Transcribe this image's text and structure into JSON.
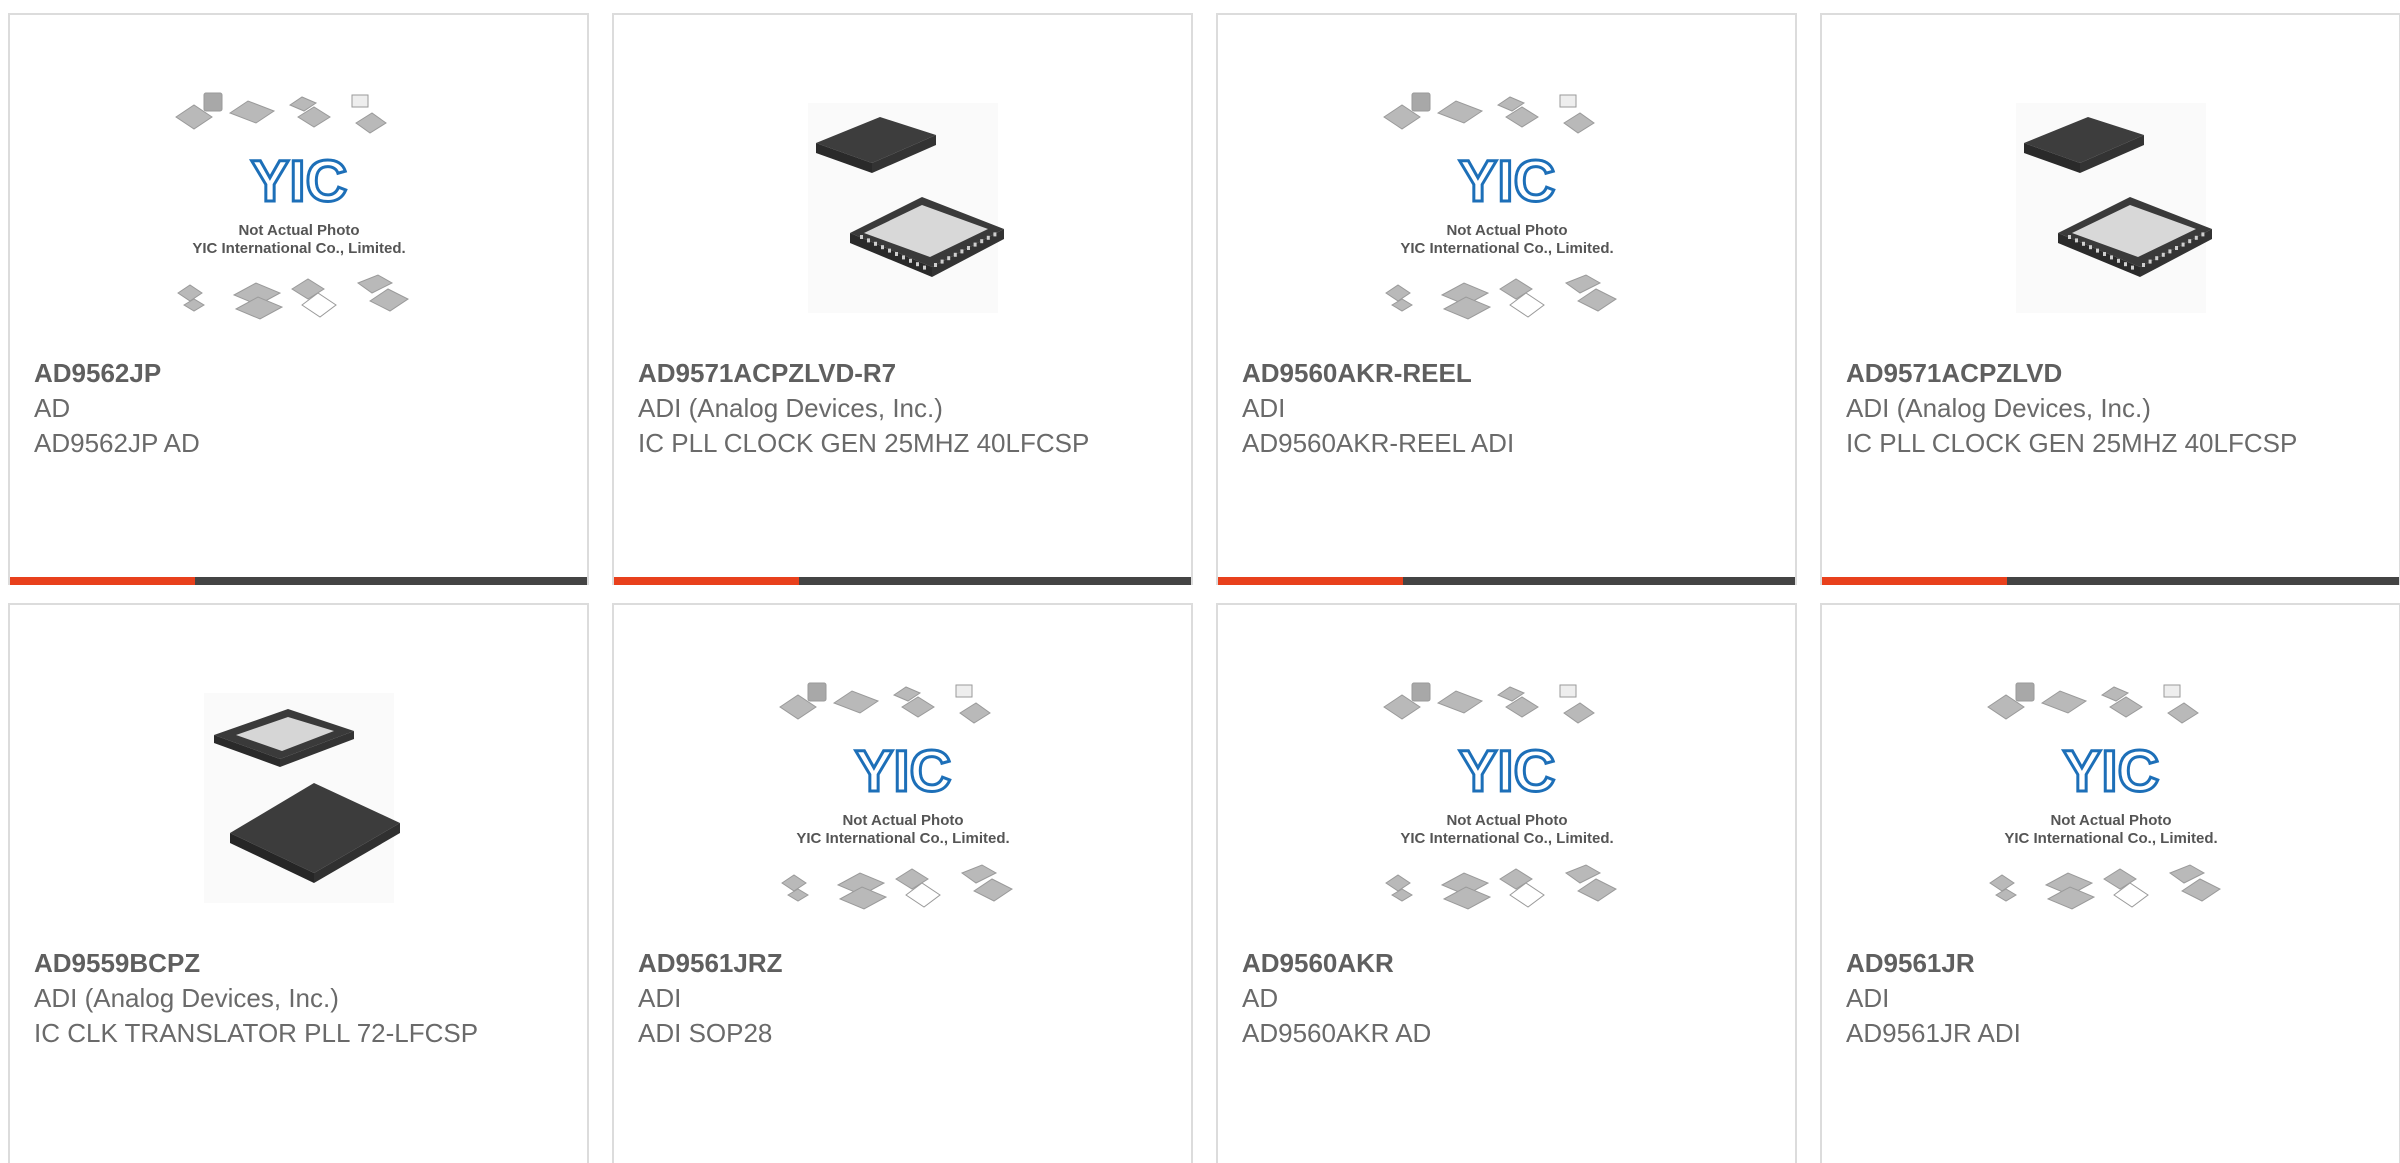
{
  "colors": {
    "accent": "#e8401c",
    "track": "#444444",
    "border": "#dcdcdc",
    "text": "#666666",
    "logo_blue": "#1d6fb8"
  },
  "placeholder": {
    "line1": "Not Actual Photo",
    "line2": "YIC International Co., Limited.",
    "logo": "YIC"
  },
  "products": [
    {
      "part_number": "AD9562JP",
      "manufacturer": "AD",
      "description": "AD9562JP AD",
      "image": "placeholder",
      "progress": 0.32
    },
    {
      "part_number": "AD9571ACPZLVD-R7",
      "manufacturer": "ADI (Analog Devices, Inc.)",
      "description": "IC PLL CLOCK GEN 25MHZ 40LFCSP",
      "image": "qfn-chip",
      "progress": 0.32
    },
    {
      "part_number": "AD9560AKR-REEL",
      "manufacturer": "ADI",
      "description": "AD9560AKR-REEL ADI",
      "image": "placeholder",
      "progress": 0.32
    },
    {
      "part_number": "AD9571ACPZLVD",
      "manufacturer": "ADI (Analog Devices, Inc.)",
      "description": "IC PLL CLOCK GEN 25MHZ 40LFCSP",
      "image": "qfn-chip",
      "progress": 0.32
    },
    {
      "part_number": "AD9559BCPZ",
      "manufacturer": "ADI (Analog Devices, Inc.)",
      "description": "IC CLK TRANSLATOR PLL 72-LFCSP",
      "image": "lfcsp-chip",
      "progress": null
    },
    {
      "part_number": "AD9561JRZ",
      "manufacturer": "ADI",
      "description": "ADI SOP28",
      "image": "placeholder",
      "progress": null
    },
    {
      "part_number": "AD9560AKR",
      "manufacturer": "AD",
      "description": "AD9560AKR AD",
      "image": "placeholder",
      "progress": null
    },
    {
      "part_number": "AD9561JR",
      "manufacturer": "ADI",
      "description": "AD9561JR ADI",
      "image": "placeholder",
      "progress": null
    }
  ]
}
